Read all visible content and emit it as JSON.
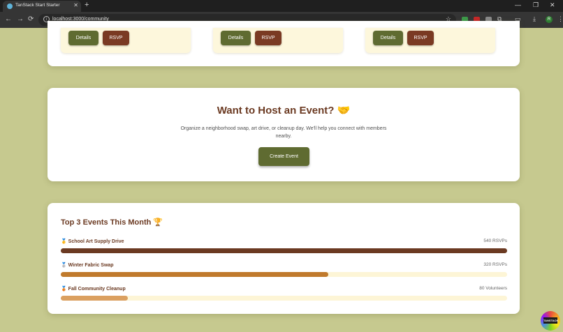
{
  "browser": {
    "tab_title": "TanStack Start Starter",
    "tab_close": "✕",
    "new_tab": "+",
    "url": "localhost:3000/community",
    "controls": {
      "minimize": "—",
      "maximize": "❐",
      "close": "✕"
    },
    "nav": {
      "back": "←",
      "forward": "→",
      "reload": "⟳"
    }
  },
  "event_cards": [
    {
      "details_label": "Details",
      "rsvp_label": "RSVP"
    },
    {
      "details_label": "Details",
      "rsvp_label": "RSVP"
    },
    {
      "details_label": "Details",
      "rsvp_label": "RSVP"
    }
  ],
  "host": {
    "title": "Want to Host an Event? 🤝",
    "description": "Organize a neighborhood swap, art drive, or cleanup day. We'll help you connect with members nearby.",
    "button_label": "Create Event"
  },
  "top_events": {
    "title": "Top 3 Events This Month 🏆",
    "items": [
      {
        "medal": "🥇",
        "name": "School Art Supply Drive",
        "count_label": "540 RSVPs",
        "fraction": 1.0,
        "color": "#6b3a22"
      },
      {
        "medal": "🥈",
        "name": "Winter Fabric Swap",
        "count_label": "320 RSVPs",
        "fraction": 0.6,
        "color": "#c07a2c"
      },
      {
        "medal": "🥉",
        "name": "Fall Community Cleanup",
        "count_label": "80 Volunteers",
        "fraction": 0.15,
        "color": "#dba060"
      }
    ]
  },
  "badge_text": "TANSTACK"
}
